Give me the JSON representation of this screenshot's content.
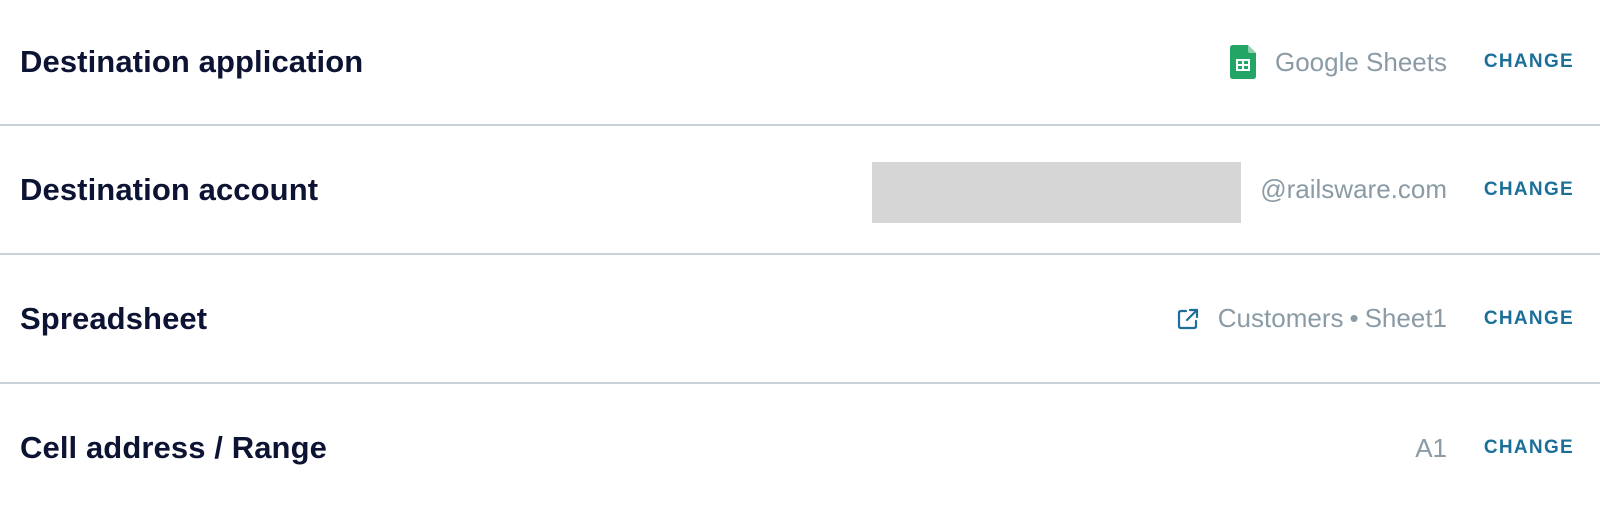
{
  "rows": [
    {
      "label": "Destination application",
      "value": "Google Sheets",
      "icon": "google-sheets-icon",
      "action": "CHANGE"
    },
    {
      "label": "Destination account",
      "value": "@railsware.com",
      "redacted": true,
      "action": "CHANGE"
    },
    {
      "label": "Spreadsheet",
      "value_parts": [
        "Customers",
        "•",
        "Sheet1"
      ],
      "icon": "external-link-icon",
      "action": "CHANGE"
    },
    {
      "label": "Cell address / Range",
      "value": "A1",
      "action": "CHANGE"
    }
  ],
  "colors": {
    "label": "#0d1333",
    "value": "#8a9ba6",
    "action": "#1c6f99",
    "divider": "#c9d3da",
    "sheets_green": "#23a566",
    "redaction": "#d6d6d6"
  }
}
